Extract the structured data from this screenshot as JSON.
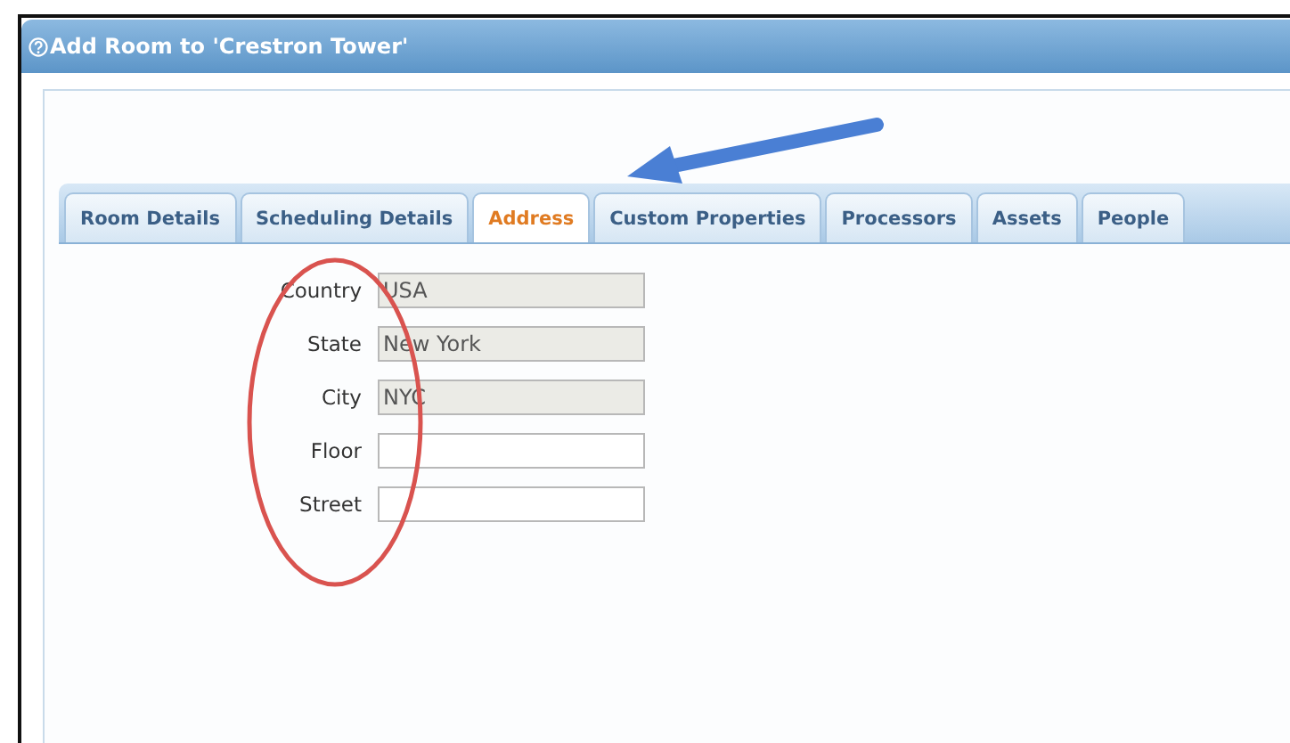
{
  "window": {
    "title": "Add Room to 'Crestron Tower'"
  },
  "tabs": [
    {
      "label": "Room Details",
      "selected": false
    },
    {
      "label": "Scheduling Details",
      "selected": false
    },
    {
      "label": "Address",
      "selected": true
    },
    {
      "label": "Custom Properties",
      "selected": false
    },
    {
      "label": "Processors",
      "selected": false
    },
    {
      "label": "Assets",
      "selected": false
    },
    {
      "label": "People",
      "selected": false
    }
  ],
  "fields": [
    {
      "label": "Country",
      "value": "USA",
      "disabled": true
    },
    {
      "label": "State",
      "value": "New York",
      "disabled": true
    },
    {
      "label": "City",
      "value": "NYC",
      "disabled": true
    },
    {
      "label": "Floor",
      "disabled": false
    },
    {
      "label": "Street",
      "disabled": false
    }
  ]
}
